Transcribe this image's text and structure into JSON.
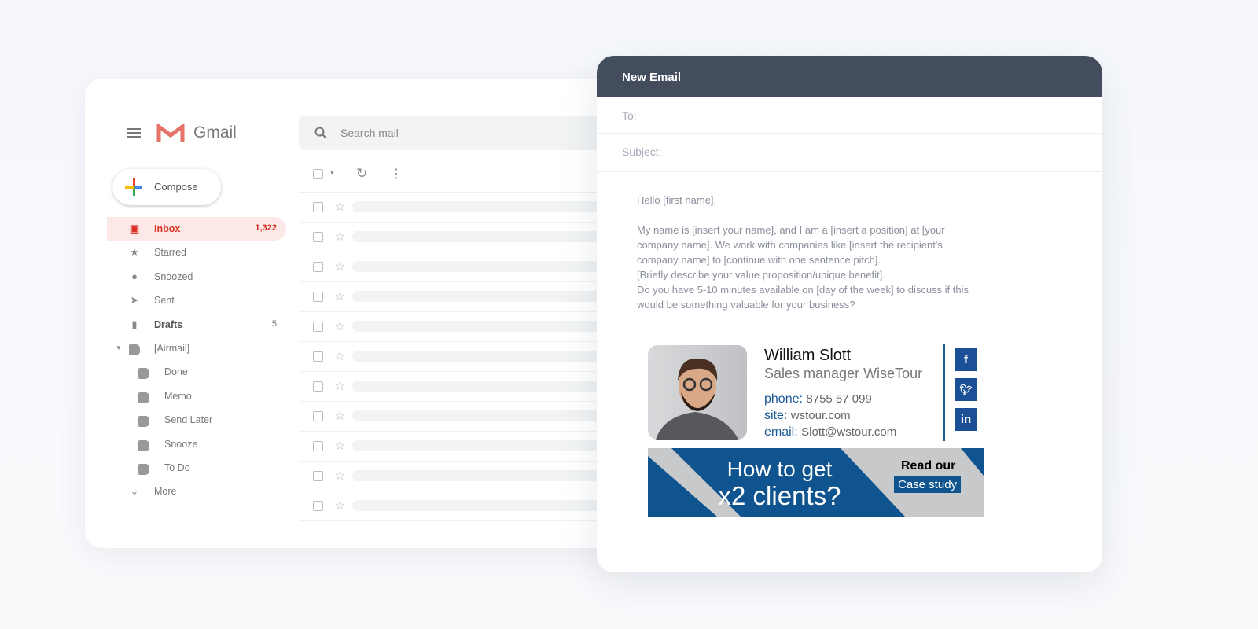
{
  "gmail": {
    "app_name": "Gmail",
    "search_placeholder": "Search mail",
    "compose_label": "Compose",
    "nav": [
      {
        "label": "Inbox",
        "count": "1,322",
        "icon": "inbox-icon"
      },
      {
        "label": "Starred",
        "icon": "star-icon"
      },
      {
        "label": "Snoozed",
        "icon": "clock-icon"
      },
      {
        "label": "Sent",
        "icon": "send-icon"
      },
      {
        "label": "Drafts",
        "count": "5",
        "icon": "draft-icon"
      },
      {
        "label": "[Airmail]",
        "icon": "label-icon"
      },
      {
        "label": "Done",
        "icon": "label-icon"
      },
      {
        "label": "Memo",
        "icon": "label-icon"
      },
      {
        "label": "Send Later",
        "icon": "label-icon"
      },
      {
        "label": "Snooze",
        "icon": "label-icon"
      },
      {
        "label": "To Do",
        "icon": "label-icon"
      },
      {
        "label": "More",
        "icon": "chevron-down-icon"
      }
    ],
    "accent": "#d93025"
  },
  "email": {
    "window_title": "New Email",
    "to_label": "To:",
    "subject_label": "Subject:",
    "greeting": "Hello [first name],",
    "body": "My name is [insert your name], and I am a [insert a position] at [your\ncompany name]. We work with companies like [insert the recipient's\ncompany name] to [continue with one sentence pitch].\n[Briefly describe your value proposition/unique benefit].\nDo you have 5-10 minutes available on [day of the week] to discuss if this\nwould be something valuable for your business?",
    "signature": {
      "name": "William Slott",
      "title": "Sales manager WiseTour",
      "phone_label": "phone:",
      "phone": "8755 57 099",
      "site_label": "site:",
      "site": "wstour.com",
      "email_label": "email:",
      "email": "Slott@wstour.com",
      "social": [
        "facebook-icon",
        "twitter-icon",
        "linkedin-icon"
      ],
      "banner": {
        "line1": "How to get",
        "line2": "x2 clients?",
        "cta_top": "Read our",
        "cta_button": "Case study"
      },
      "brand_color": "#1b5a96"
    }
  }
}
